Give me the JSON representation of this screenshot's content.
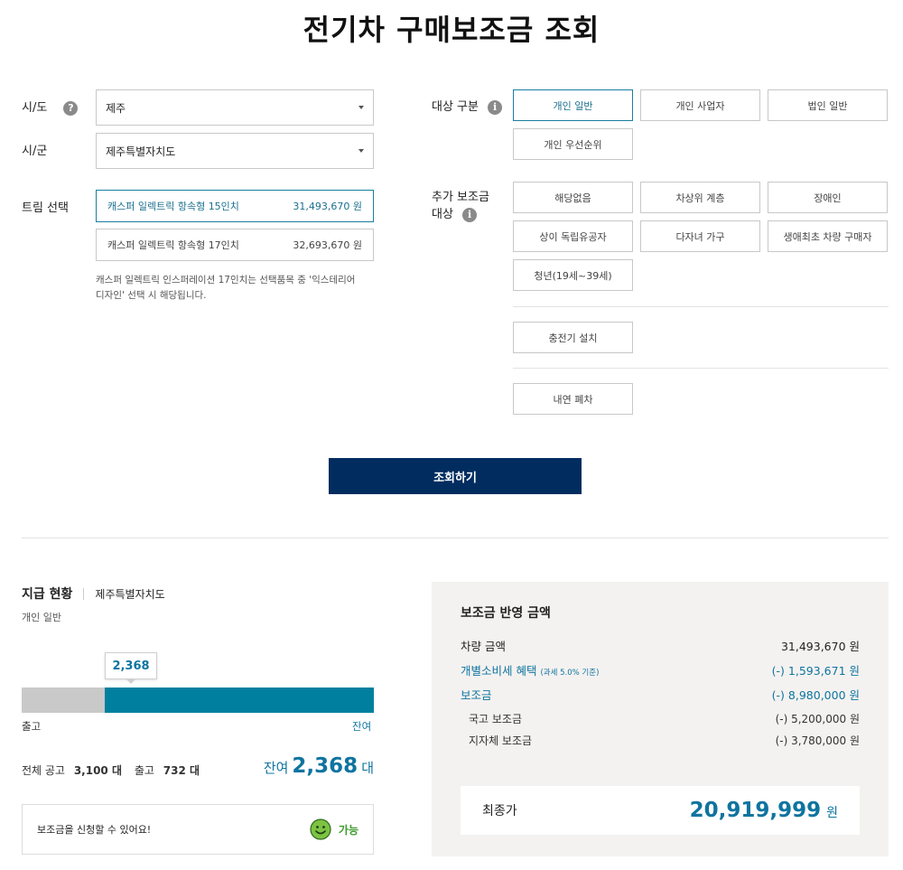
{
  "page_title": "전기차 구매보조금 조회",
  "region": {
    "sido_label": "시/도",
    "sido_value": "제주",
    "sigun_label": "시/군",
    "sigun_value": "제주특별자치도"
  },
  "trim": {
    "label": "트림 선택",
    "options": [
      {
        "name": "캐스퍼 일렉트릭 항속형 15인치",
        "price": "31,493,670 원",
        "selected": true
      },
      {
        "name": "캐스퍼 일렉트릭 항속형 17인치",
        "price": "32,693,670 원",
        "selected": false
      }
    ],
    "note_line1": "캐스퍼 일렉트릭 인스퍼레이션 17인치는 선택품목 중 '익스테리어",
    "note_line2": "디자인' 선택 시 해당됩니다."
  },
  "target": {
    "label": "대상 구분",
    "options": [
      "개인 일반",
      "개인 사업자",
      "법인 일반",
      "개인 우선순위"
    ],
    "selected": "개인 일반"
  },
  "extra": {
    "label_line1": "추가 보조금",
    "label_line2": "대상",
    "options": [
      "해당없음",
      "차상위 계층",
      "장애인",
      "상이 독립유공자",
      "다자녀 가구",
      "생애최초 차량 구매자",
      "청년(19세~39세)"
    ],
    "charger": "충전기 설치",
    "scrap": "내연 폐차"
  },
  "search_button": "조회하기",
  "status": {
    "title": "지급 현황",
    "region": "제주특별자치도",
    "category": "개인 일반",
    "remaining_tooltip": "2,368",
    "released_fraction": 0.2361,
    "bar_left_label": "출고",
    "bar_right_label": "잔여",
    "total_label": "전체 공고",
    "total_value": "3,100 대",
    "released_label": "출고",
    "released_value": "732 대",
    "remaining_prefix": "잔여",
    "remaining_value": "2,368",
    "remaining_unit": "대",
    "notice": "보조금을 신청할 수 있어요!",
    "available": "가능"
  },
  "summary": {
    "title": "보조금 반영 금액",
    "vehicle_label": "차량 금액",
    "vehicle_value": "31,493,670 원",
    "tax_label": "개별소비세 혜택",
    "tax_note": "(과세 5.0% 기준)",
    "tax_value": "(-) 1,593,671 원",
    "subsidy_label": "보조금",
    "subsidy_value": "(-) 8,980,000 원",
    "national_label": "국고 보조금",
    "national_value": "(-) 5,200,000 원",
    "local_label": "지자체 보조금",
    "local_value": "(-) 3,780,000 원",
    "final_label": "최종가",
    "final_value": "20,919,999",
    "final_unit": "원"
  },
  "colors": {
    "accent": "#0f74a0",
    "primary_button": "#002c5f",
    "bar_remaining": "#00809e",
    "bar_released": "#c9c9c9",
    "summary_bg": "#f4f2f0"
  }
}
